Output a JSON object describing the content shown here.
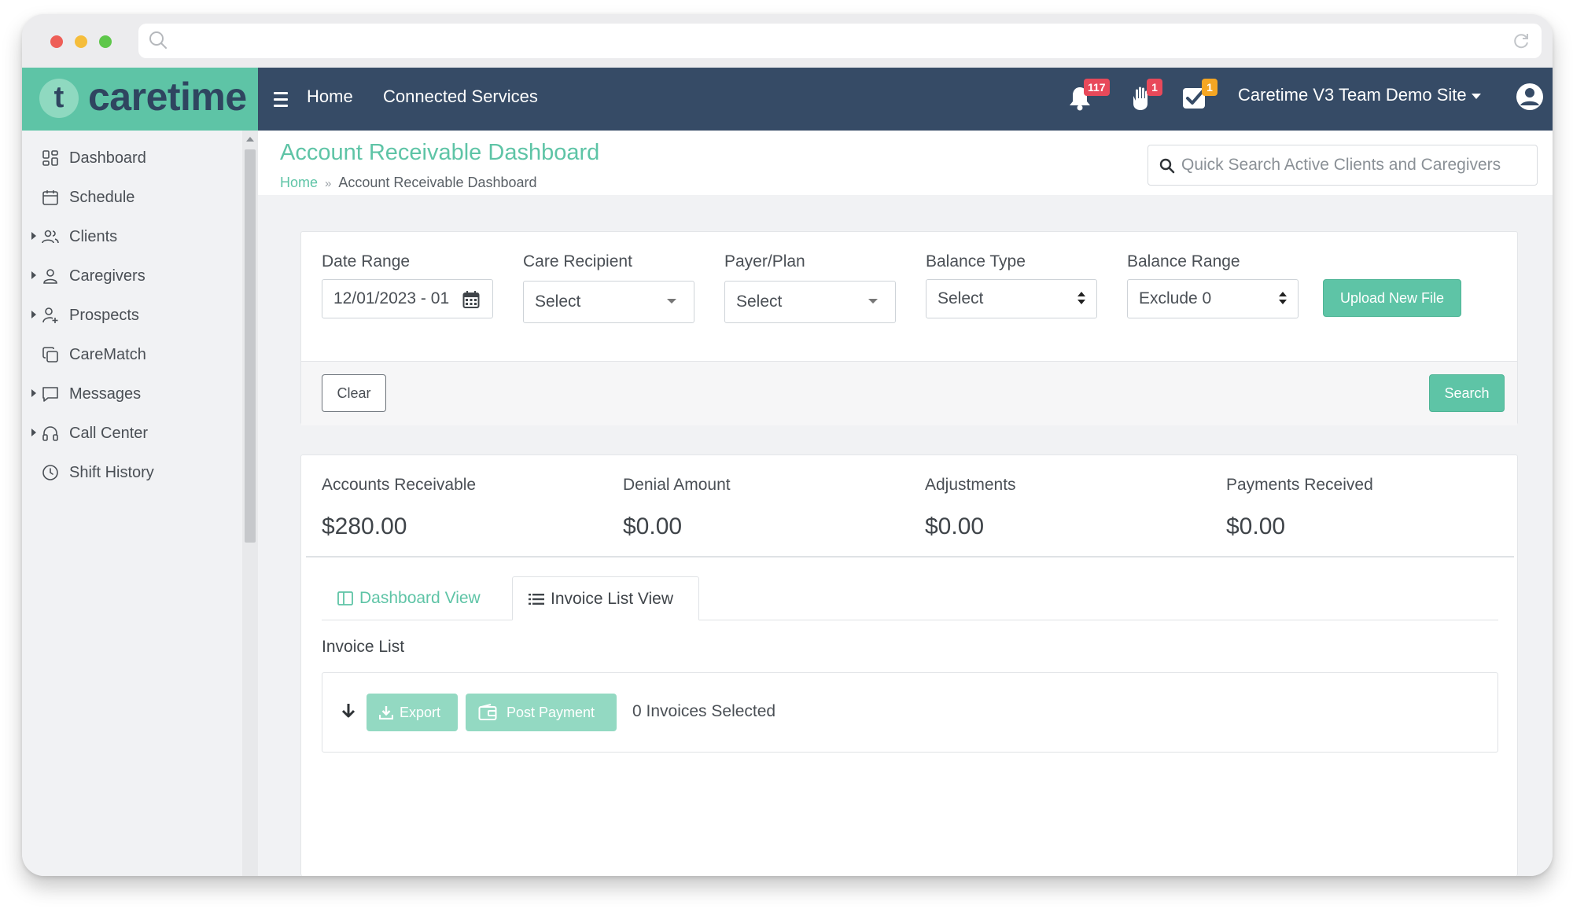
{
  "app": {
    "logo_letter": "t",
    "logo_text": "caretime",
    "brand_color": "#5ec4a6",
    "header_color": "#364b66"
  },
  "nav": {
    "home": "Home",
    "connected_services": "Connected Services",
    "notifications_badge": "117",
    "hand_badge": "1",
    "tasks_badge": "1",
    "site_name": "Caretime V3 Team Demo Site"
  },
  "sidebar": {
    "items": [
      {
        "label": "Dashboard",
        "icon": "grid-icon"
      },
      {
        "label": "Schedule",
        "icon": "calendar-icon"
      },
      {
        "label": "Clients",
        "icon": "users-icon"
      },
      {
        "label": "Caregivers",
        "icon": "user-icon"
      },
      {
        "label": "Prospects",
        "icon": "user-plus-icon"
      },
      {
        "label": "CareMatch",
        "icon": "copy-icon"
      },
      {
        "label": "Messages",
        "icon": "message-icon"
      },
      {
        "label": "Call Center",
        "icon": "headset-icon"
      },
      {
        "label": "Shift History",
        "icon": "clock-icon"
      }
    ]
  },
  "page": {
    "title": "Account Receivable Dashboard",
    "breadcrumb_home": "Home",
    "breadcrumb_sep": "»",
    "breadcrumb_current": "Account Receivable Dashboard",
    "quick_search_placeholder": "Quick Search Active Clients and Caregivers"
  },
  "filters": {
    "date_range_label": "Date Range",
    "date_range_value": "12/01/2023 - 01",
    "care_recipient_label": "Care Recipient",
    "care_recipient_value": "Select",
    "payer_plan_label": "Payer/Plan",
    "payer_plan_value": "Select",
    "balance_type_label": "Balance Type",
    "balance_type_value": "Select",
    "balance_range_label": "Balance Range",
    "balance_range_value": "Exclude 0",
    "upload_button": "Upload New File",
    "clear_button": "Clear",
    "search_button": "Search"
  },
  "summary": {
    "accounts_receivable_label": "Accounts Receivable",
    "accounts_receivable_value": "$280.00",
    "denial_amount_label": "Denial Amount",
    "denial_amount_value": "$0.00",
    "adjustments_label": "Adjustments",
    "adjustments_value": "$0.00",
    "payments_received_label": "Payments Received",
    "payments_received_value": "$0.00"
  },
  "tabs": {
    "dashboard_view": "Dashboard View",
    "invoice_list_view": "Invoice List View",
    "active": "invoice_list_view"
  },
  "invoice": {
    "title": "Invoice List",
    "export_button": "Export",
    "post_payment_button": "Post Payment",
    "selected_text": "0 Invoices Selected"
  }
}
